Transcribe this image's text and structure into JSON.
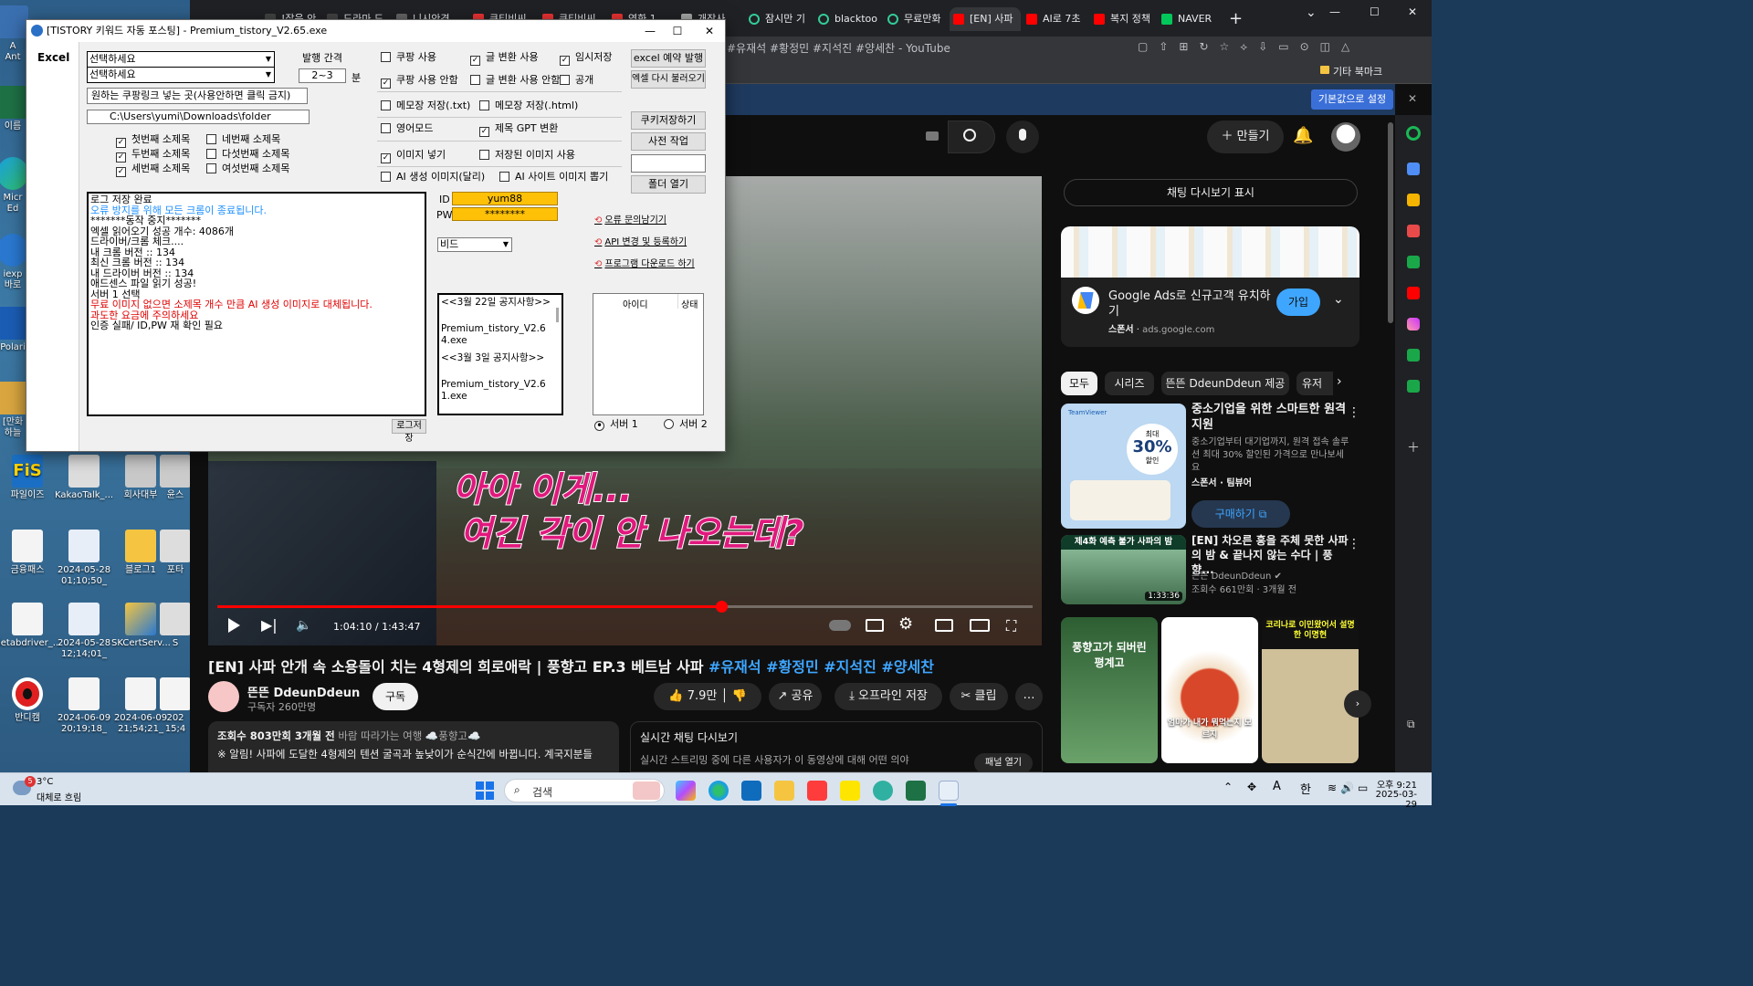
{
  "desktop": {
    "icons": [
      {
        "label": "A\nAnt"
      },
      {
        "label": "이름"
      },
      {
        "label": "Micr\nEd"
      },
      {
        "label": "iexp\n바로"
      },
      {
        "label": "Polari"
      },
      {
        "label": "[만화\n하늘"
      },
      {
        "label": "파일이즈"
      },
      {
        "label": "KakaoTalk_..."
      },
      {
        "label": "회사대부"
      },
      {
        "label": "윤스"
      },
      {
        "label": "금융패스"
      },
      {
        "label": "2024-05-28\n01;10;50_"
      },
      {
        "label": "블로그1"
      },
      {
        "label": "포타"
      },
      {
        "label": "ietabdriver_..."
      },
      {
        "label": "2024-05-28\n12;14;01_"
      },
      {
        "label": "SKCertServ..."
      },
      {
        "label": "S"
      },
      {
        "label": "반디캠"
      },
      {
        "label": "2024-06-09\n20;19;18_"
      },
      {
        "label": "2024-06-09\n21;54;21_"
      },
      {
        "label": "202\n15;4"
      }
    ]
  },
  "browser": {
    "tabs": [
      {
        "label": "!잡음 안"
      },
      {
        "label": "드라마 드"
      },
      {
        "label": "니시안경"
      },
      {
        "label": "쿠티비씨"
      },
      {
        "label": "쿠티비씨"
      },
      {
        "label": "영화 1"
      },
      {
        "label": "개장사"
      },
      {
        "label": "잠시만 기"
      },
      {
        "label": "blacktoo"
      },
      {
        "label": "무료만화"
      },
      {
        "label": "[EN] 사파"
      },
      {
        "label": "AI로 7초"
      },
      {
        "label": "복지 정책"
      },
      {
        "label": "NAVER"
      }
    ],
    "new_tab": "+",
    "window_controls": {
      "minimize": "—",
      "maximize": "☐",
      "close": "✕"
    },
    "address_fragment": "#유재석 #황정민 #지석진 #양세찬 - YouTube",
    "bookmark_folder": "기타 북마크",
    "infobar_button": "기본값으로 설정",
    "infobar_close": "✕"
  },
  "youtube": {
    "create_button": "만들기",
    "video_title_plain": "[EN] 사파 안개 속 소용돌이 치는 4형제의 희로애락 | 풍향고 EP.3 베트남 사파 ",
    "video_title_tags": "#유재석 #황정민 #지석진 #양세찬",
    "subtitle_line1": "아아 이게...",
    "subtitle_line2": "여긴 각이 안 나오는데?",
    "time_display": "1:04:10 / 1:43:47",
    "progress": 0.618,
    "channel_name": "뜬뜬 DdeunDdeun",
    "subscribers": "구독자 260만명",
    "subscribe_button": "구독",
    "likes": "7.9만",
    "share": "공유",
    "download": "오프라인 저장",
    "clip": "클립",
    "more": "…",
    "desc_views": "조회수 803만회  3개월 전",
    "desc_tags": " 바람 따라가는 여행 ☁️풍향고☁️",
    "desc_text": "※ 알림! 사파에 도달한 4형제의 텐션 굴곡과 높낮이가 순식간에 바뀝니다. 계국지분들",
    "live_chat_title": "실시간 채팅 다시보기",
    "live_chat_text": "실시간 스트리밍 중에 다른 사용자가 이 동영상에 대해 어떤 의야",
    "live_chat_button": "패널 열기",
    "chat_replay_button": "채팅 다시보기 표시",
    "ad": {
      "title": "Google Ads로 신규고객 유치하기",
      "sponsor": "스폰서",
      "domain": "ads.google.com",
      "button": "가입"
    },
    "chips": [
      "모두",
      "시리즈",
      "뜬뜬 DdeunDdeun 제공",
      "유저"
    ],
    "recommend": [
      {
        "title": "중소기업을 위한 스마트한 원격 지원",
        "desc": "중소기업부터 대기업까지, 원격 접속 솔루션 최대 30% 할인된 가격으로 만나보세요",
        "meta": "스폰서 · 팀뷰어",
        "button": "구매하기",
        "badge_top": "최대",
        "badge": "30%",
        "badge_sub": "할인",
        "brand": "TeamViewer"
      },
      {
        "title": "[EN] 차오른 흥을 주체 못한 사파의 밤 & 끝나지 않는 수다 | 풍향...",
        "channel": "뜬뜬 DdeunDdeun",
        "meta": "조회수 661만회 · 3개월 전",
        "duration": "1:33:36",
        "thumb_text": "제4화 예측 불가 사파의 밤"
      }
    ],
    "shorts": [
      {
        "text": "풍향고가 되버린 평계고"
      },
      {
        "text": "엄마가 내가 뭐먹는지 모르지"
      },
      {
        "text": "코리나로 이민왔어서 설명한 이명현"
      }
    ]
  },
  "app": {
    "title": "[TISTORY 키워드 자동 포스팅] - Premium_tistory_V2.65.exe",
    "tab_excel": "Excel",
    "combo1": "선택하세요",
    "combo2": "선택하세요",
    "interval_label": "발행 간격",
    "interval_value": "2~3",
    "interval_unit": "분",
    "coupang_hint": "원하는 쿠팡링크 넣는 곳(사용안하면 클릭 금지)",
    "folder_path": "C:\\Users\\yumi\\Downloads\\folder",
    "subtitle_checks": [
      {
        "label": "첫번째 소제목",
        "checked": true
      },
      {
        "label": "네번째 소제목",
        "checked": false
      },
      {
        "label": "두번째 소제목",
        "checked": true
      },
      {
        "label": "다섯번째 소제목",
        "checked": false
      },
      {
        "label": "세번째 소제목",
        "checked": true
      },
      {
        "label": "여섯번째 소제목",
        "checked": false
      }
    ],
    "options": [
      {
        "label": "쿠팡 사용",
        "checked": false
      },
      {
        "label": "글 변환 사용",
        "checked": true
      },
      {
        "label": "임시저장",
        "checked": true
      },
      {
        "label": "쿠팡 사용 안함",
        "checked": true
      },
      {
        "label": "글 변환 사용 안함",
        "checked": false
      },
      {
        "label": "공개",
        "checked": false
      },
      {
        "label": "메모장 저장(.txt)",
        "checked": false
      },
      {
        "label": "메모장 저장(.html)",
        "checked": false
      },
      {
        "label": "영어모드",
        "checked": false
      },
      {
        "label": "제목 GPT 변환",
        "checked": true
      },
      {
        "label": "이미지 넣기",
        "checked": true
      },
      {
        "label": "저장된 이미지 사용",
        "checked": false
      },
      {
        "label": "AI 생성 이미지(달리)",
        "checked": false
      },
      {
        "label": "AI 사이트 이미지 뽑기",
        "checked": false
      }
    ],
    "buttons": {
      "excel_reserve": "excel 예약 발행",
      "excel_reload": "엑셀 다시 불러오기",
      "cookie_save": "쿠키저장하기",
      "pre_work": "사전 작업",
      "folder_open": "폴더 열기",
      "log_save": "로그저장"
    },
    "log_lines": [
      {
        "text": "로그 저장 완료",
        "color": "#000000"
      },
      {
        "text": "오류 방지를 위해 모든 크롬이 종료됩니다.",
        "color": "#1e90ff"
      },
      {
        "text": "*******동작 중지*******",
        "color": "#000000"
      },
      {
        "text": "엑셀 읽어오기 성공 개수: 4086개",
        "color": "#000000"
      },
      {
        "text": "드라이버/크롬 체크....",
        "color": "#000000"
      },
      {
        "text": "내 크롬 버전 :: 134",
        "color": "#000000"
      },
      {
        "text": "최신 크롬 버전 :: 134",
        "color": "#000000"
      },
      {
        "text": "내 드라이버 버전 :: 134",
        "color": "#000000"
      },
      {
        "text": "애드센스 파일 읽기 성공!",
        "color": "#000000"
      },
      {
        "text": "서버 1 선택",
        "color": "#000000"
      },
      {
        "text": "무료 이미지 없으면 소제목 개수 만큼 AI 생성 이미지로 대체됩니다.",
        "color": "#e00000"
      },
      {
        "text": "과도한 요금에 주의하세요",
        "color": "#e00000"
      },
      {
        "text": "인증 실패/ ID,PW 재 확인 필요",
        "color": "#000000"
      }
    ],
    "id_label": "ID",
    "id_value": "yum88",
    "pw_label": "PW",
    "pw_value": "********",
    "model_combo": "비드",
    "links": [
      "오류 문의남기기",
      "API 변경 및 등록하기",
      "프로그램 다운로드 하기"
    ],
    "notice_lines": [
      "<<3월 22일 공지사항>>",
      "Premium_tistory_V2.64.exe",
      "<<3월 3일 공지사항>>",
      "Premium_tistory_V2.61.exe"
    ],
    "account_headers": [
      "아이디",
      "상태"
    ],
    "servers": [
      {
        "label": "서버 1",
        "selected": true
      },
      {
        "label": "서버 2",
        "selected": false
      }
    ]
  },
  "taskbar": {
    "weather_temp": "3°C",
    "weather_desc": "대체로 흐림",
    "weather_badge": "5",
    "search": "검색",
    "ime": "A",
    "lang": "한",
    "time": "오후 9:21",
    "date": "2025-03-29"
  },
  "colors": {
    "youtube_red": "#ff0000",
    "accent_blue": "#3ea6ff",
    "subtitle_pink": "#e0197d"
  }
}
